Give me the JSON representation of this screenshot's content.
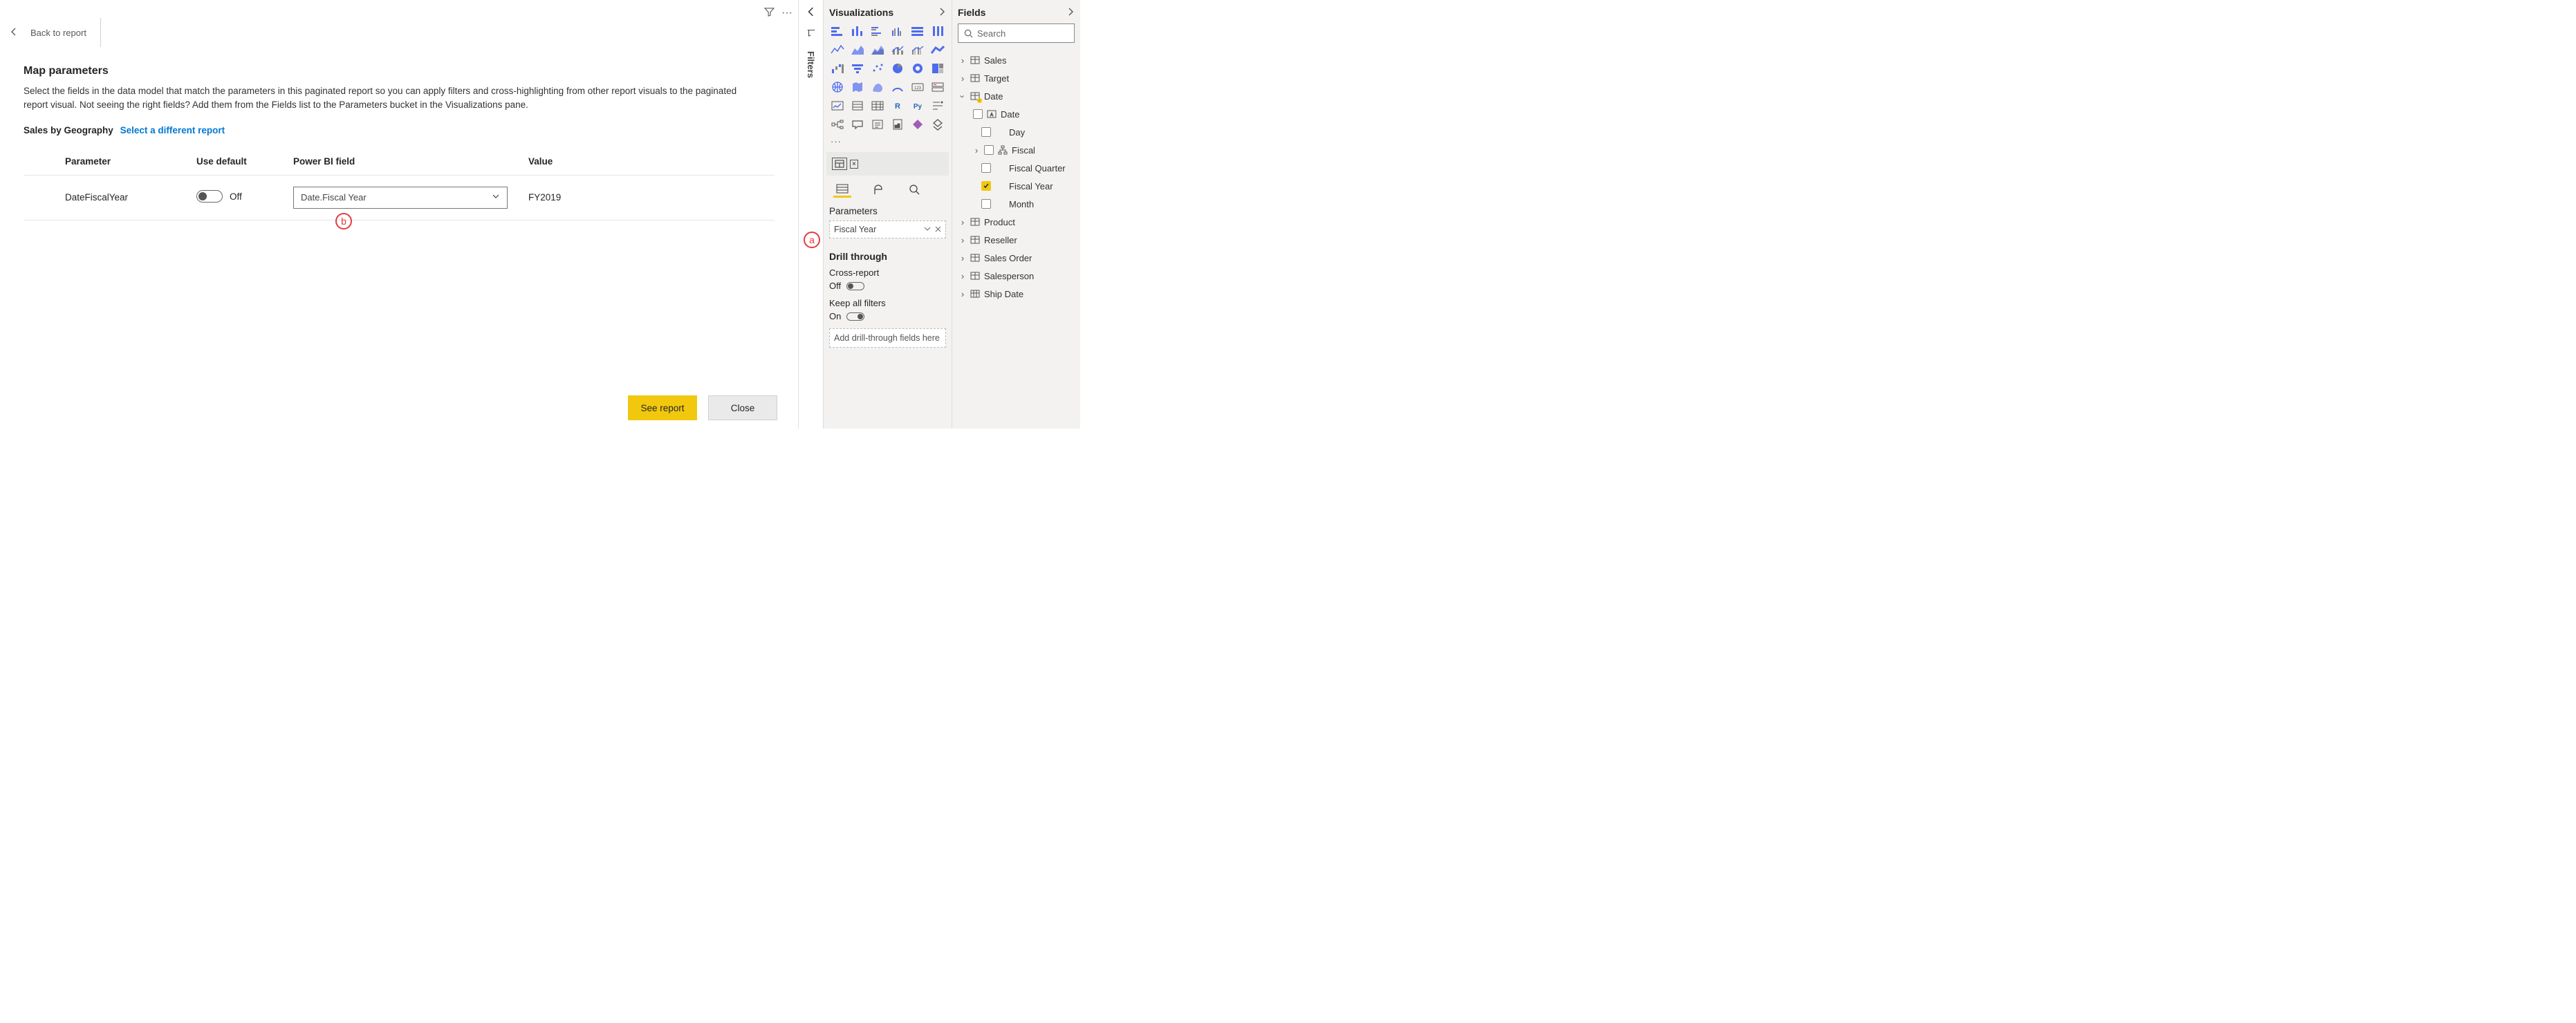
{
  "header": {
    "back_label": "Back to report"
  },
  "title": "Map parameters",
  "description": "Select the fields in the data model that match the parameters in this paginated report so you can apply filters and cross-highlighting from other report visuals to the paginated report visual. Not seeing the right fields? Add them from the Fields list to the Parameters bucket in the Visualizations pane.",
  "report_name": "Sales by Geography",
  "select_different": "Select a different report",
  "table": {
    "headers": {
      "parameter": "Parameter",
      "use_default": "Use default",
      "pbi_field": "Power BI field",
      "value": "Value"
    },
    "row": {
      "parameter": "DateFiscalYear",
      "toggle_label": "Off",
      "pbi_field": "Date.Fiscal Year",
      "value": "FY2019"
    }
  },
  "buttons": {
    "see_report": "See report",
    "close": "Close"
  },
  "filters_rail": "Filters",
  "viz_pane": {
    "title": "Visualizations",
    "build_xi_label": "x",
    "parameters_label": "Parameters",
    "well_field": "Fiscal Year",
    "drill_title": "Drill through",
    "cross_report_label": "Cross-report",
    "cross_report_state": "Off",
    "keep_filters_label": "Keep all filters",
    "keep_filters_state": "On",
    "drop_hint": "Add drill-through fields here"
  },
  "fields_pane": {
    "title": "Fields",
    "search_placeholder": "Search",
    "tables": {
      "sales": "Sales",
      "target": "Target",
      "date": "Date",
      "date_children": {
        "date": "Date",
        "day": "Day",
        "fiscal": "Fiscal",
        "fq": "Fiscal Quarter",
        "fy": "Fiscal Year",
        "month": "Month"
      },
      "product": "Product",
      "reseller": "Reseller",
      "sales_order": "Sales Order",
      "salesperson": "Salesperson",
      "ship_date": "Ship Date"
    }
  },
  "callouts": {
    "a": "a",
    "b": "b"
  }
}
